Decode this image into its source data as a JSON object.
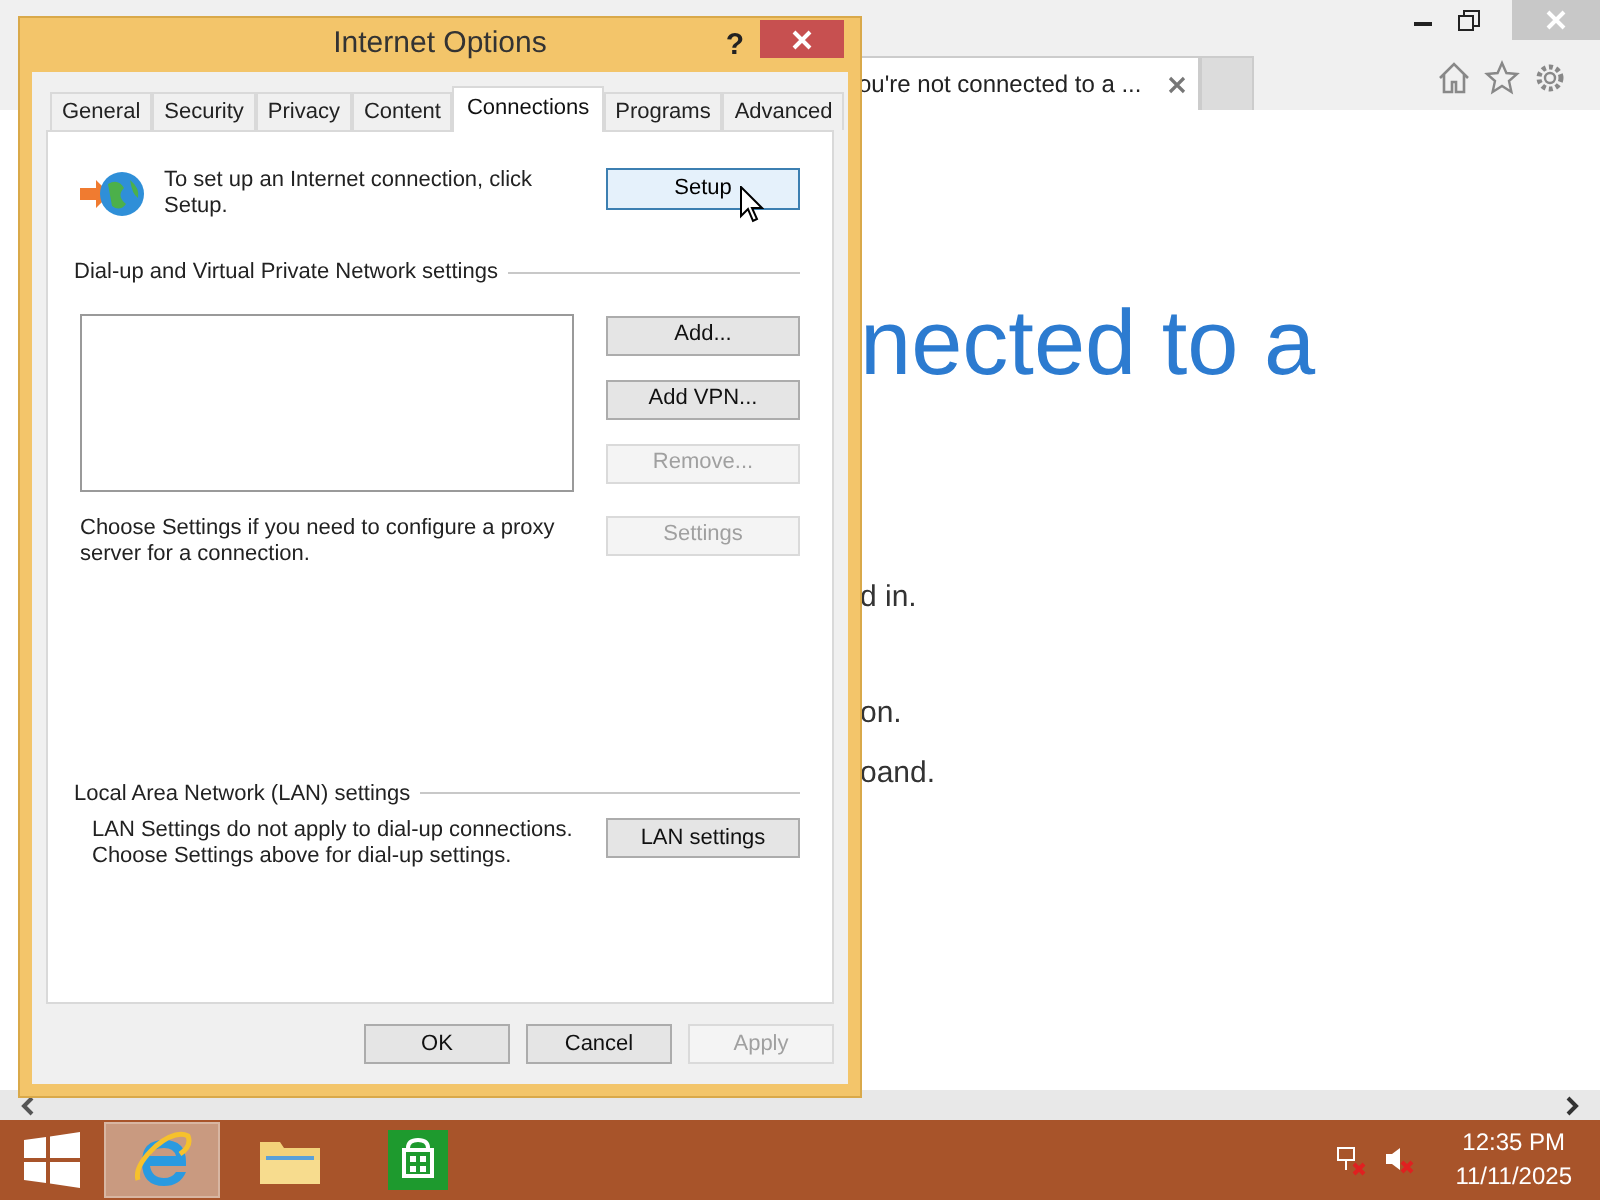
{
  "browser": {
    "tabs": [
      {
        "label": "ou're not connected to a ...",
        "selected": true
      },
      {
        "selected": false
      }
    ],
    "page_heading": "nected to a",
    "page_lines": [
      "d in.",
      "on.",
      "oand."
    ]
  },
  "dialog": {
    "title": "Internet Options",
    "help": "?",
    "tabs": [
      {
        "label": "General",
        "selected": false
      },
      {
        "label": "Security",
        "selected": false
      },
      {
        "label": "Privacy",
        "selected": false
      },
      {
        "label": "Content",
        "selected": false
      },
      {
        "label": "Connections",
        "selected": true
      },
      {
        "label": "Programs",
        "selected": false
      },
      {
        "label": "Advanced",
        "selected": false
      }
    ],
    "setup_text": "To set up an Internet connection, click Setup.",
    "setup_button": {
      "label": "Setup",
      "hovered": true
    },
    "vpn_section": "Dial-up and Virtual Private Network settings",
    "vpn_buttons": [
      {
        "label": "Add...",
        "disabled": false
      },
      {
        "label": "Add VPN...",
        "disabled": false
      },
      {
        "label": "Remove...",
        "disabled": true
      }
    ],
    "proxy_text": "Choose Settings if you need to configure a proxy server for a connection.",
    "settings_button": {
      "label": "Settings",
      "disabled": true
    },
    "lan_section": "Local Area Network (LAN) settings",
    "lan_text": "LAN Settings do not apply to dial-up connections. Choose Settings above for dial-up settings.",
    "lan_button": {
      "label": "LAN settings",
      "disabled": false
    },
    "footer_buttons": [
      {
        "label": "OK",
        "disabled": false
      },
      {
        "label": "Cancel",
        "disabled": false
      },
      {
        "label": "Apply",
        "disabled": true
      }
    ]
  },
  "taskbar": {
    "apps": [
      {
        "kind": "ie",
        "selected": true
      },
      {
        "kind": "explorer",
        "selected": false
      },
      {
        "kind": "store",
        "selected": false
      }
    ],
    "time": "12:35 PM",
    "date": "11/11/2025"
  }
}
